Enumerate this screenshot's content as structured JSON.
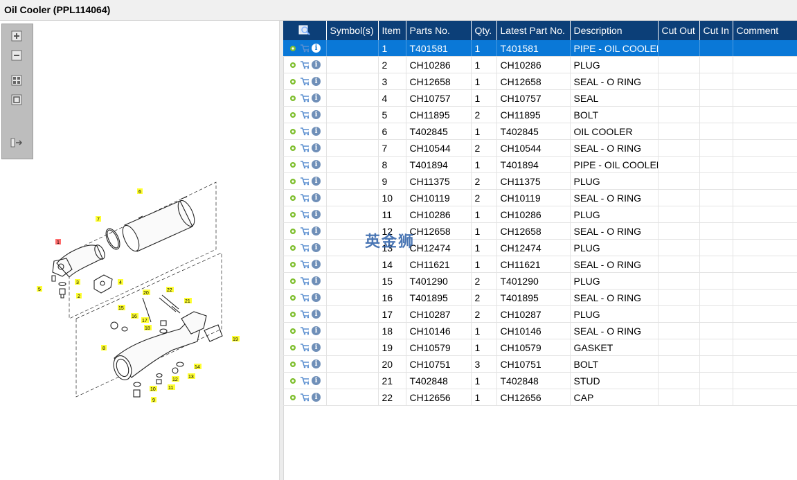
{
  "window": {
    "title": "Oil Cooler (PPL114064)"
  },
  "toolbox": {
    "tools": [
      "zoom-in-icon",
      "zoom-out-icon",
      "fit-page-icon",
      "actual-size-icon",
      "toggle-list-icon"
    ]
  },
  "watermark": "英金狮",
  "drawing": {
    "callouts": [
      "1",
      "2",
      "3",
      "4",
      "5",
      "6",
      "7",
      "8",
      "9",
      "10",
      "11",
      "12",
      "13",
      "14",
      "15",
      "16",
      "17",
      "18",
      "19",
      "20",
      "21",
      "22"
    ]
  },
  "table": {
    "headers": {
      "symbols": "Symbol(s)",
      "item": "Item",
      "parts_no": "Parts No.",
      "qty": "Qty.",
      "latest_part_no": "Latest Part No.",
      "description": "Description",
      "cut_out": "Cut Out",
      "cut_in": "Cut In",
      "comment": "Comment"
    },
    "rows": [
      {
        "item": "1",
        "parts_no": "T401581",
        "qty": "1",
        "latest": "T401581",
        "desc": "PIPE - OIL COOLER"
      },
      {
        "item": "2",
        "parts_no": "CH10286",
        "qty": "1",
        "latest": "CH10286",
        "desc": "PLUG"
      },
      {
        "item": "3",
        "parts_no": "CH12658",
        "qty": "1",
        "latest": "CH12658",
        "desc": "SEAL - O RING"
      },
      {
        "item": "4",
        "parts_no": "CH10757",
        "qty": "1",
        "latest": "CH10757",
        "desc": "SEAL"
      },
      {
        "item": "5",
        "parts_no": "CH11895",
        "qty": "2",
        "latest": "CH11895",
        "desc": "BOLT"
      },
      {
        "item": "6",
        "parts_no": "T402845",
        "qty": "1",
        "latest": "T402845",
        "desc": "OIL COOLER"
      },
      {
        "item": "7",
        "parts_no": "CH10544",
        "qty": "2",
        "latest": "CH10544",
        "desc": "SEAL - O RING"
      },
      {
        "item": "8",
        "parts_no": "T401894",
        "qty": "1",
        "latest": "T401894",
        "desc": "PIPE - OIL COOLER"
      },
      {
        "item": "9",
        "parts_no": "CH11375",
        "qty": "2",
        "latest": "CH11375",
        "desc": "PLUG"
      },
      {
        "item": "10",
        "parts_no": "CH10119",
        "qty": "2",
        "latest": "CH10119",
        "desc": "SEAL - O RING"
      },
      {
        "item": "11",
        "parts_no": "CH10286",
        "qty": "1",
        "latest": "CH10286",
        "desc": "PLUG"
      },
      {
        "item": "12",
        "parts_no": "CH12658",
        "qty": "1",
        "latest": "CH12658",
        "desc": "SEAL - O RING"
      },
      {
        "item": "13",
        "parts_no": "CH12474",
        "qty": "1",
        "latest": "CH12474",
        "desc": "PLUG"
      },
      {
        "item": "14",
        "parts_no": "CH11621",
        "qty": "1",
        "latest": "CH11621",
        "desc": "SEAL - O RING"
      },
      {
        "item": "15",
        "parts_no": "T401290",
        "qty": "2",
        "latest": "T401290",
        "desc": "PLUG"
      },
      {
        "item": "16",
        "parts_no": "T401895",
        "qty": "2",
        "latest": "T401895",
        "desc": "SEAL - O RING"
      },
      {
        "item": "17",
        "parts_no": "CH10287",
        "qty": "2",
        "latest": "CH10287",
        "desc": "PLUG"
      },
      {
        "item": "18",
        "parts_no": "CH10146",
        "qty": "1",
        "latest": "CH10146",
        "desc": "SEAL - O RING"
      },
      {
        "item": "19",
        "parts_no": "CH10579",
        "qty": "1",
        "latest": "CH10579",
        "desc": "GASKET"
      },
      {
        "item": "20",
        "parts_no": "CH10751",
        "qty": "3",
        "latest": "CH10751",
        "desc": "BOLT"
      },
      {
        "item": "21",
        "parts_no": "T402848",
        "qty": "1",
        "latest": "T402848",
        "desc": "STUD"
      },
      {
        "item": "22",
        "parts_no": "CH12656",
        "qty": "1",
        "latest": "CH12656",
        "desc": "CAP"
      }
    ],
    "selected_row": 0
  },
  "colors": {
    "header_bg": "#0c3f78",
    "selected_row": "#0a78d7",
    "callout_yellow": "#ffff33",
    "callout_red": "#ff6b6b"
  }
}
